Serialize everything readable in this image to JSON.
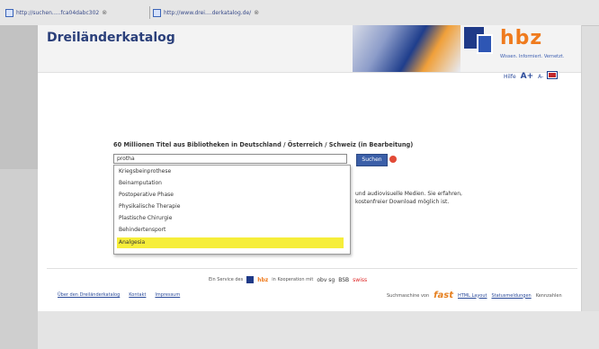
{
  "browser": {
    "tabs": [
      {
        "label": "http://suchen.....fca04dabc302"
      },
      {
        "label": "http://www.drei....derkatalog.de/"
      }
    ]
  },
  "page": {
    "title": "Dreiländerkatalog",
    "logo": {
      "text": "hbz",
      "tagline": "Wissen. Informiert. Vernetzt."
    },
    "utils": {
      "help": "Hilfe",
      "font_up": "A+",
      "font_down": "A-"
    },
    "headline": "60 Millionen Titel aus Bibliotheken in Deutschland / Österreich / Schweiz (in Bearbeitung)",
    "search": {
      "value": "protha",
      "button": "Suchen"
    },
    "suggestions": [
      {
        "label": "Kriegsbeinprothese",
        "selected": false
      },
      {
        "label": "Beinamputation",
        "selected": false
      },
      {
        "label": "Postoperative Phase",
        "selected": false
      },
      {
        "label": "Physikalische Therapie",
        "selected": false
      },
      {
        "label": "Plastische Chirurgie",
        "selected": false
      },
      {
        "label": "Behindertensport",
        "selected": false
      },
      {
        "label": "Analgesia",
        "selected": true
      }
    ],
    "description": {
      "line1": "und audiovisuelle Medien. Sie erfahren,",
      "line2": "kostenfreier Download möglich ist."
    },
    "footer": {
      "service_prefix": "Ein Service des",
      "service_hbz": "hbz",
      "service_mid": "in Kooperation mit",
      "partner1": "obv sg",
      "partner2": "BSB",
      "partner3": "swiss",
      "links": [
        "Über den Dreiländerkatalog",
        "Kontakt",
        "Impressum"
      ],
      "engine_label": "Suchmaschine von",
      "engine": "fast",
      "right_links": [
        "HTML Layout",
        "Statusmeldungen"
      ],
      "right_tail": "Kennzahlen"
    }
  },
  "colors": {
    "accent": "#2a3f7a",
    "brand": "#ef7b1e",
    "highlight": "#f6ee3a"
  }
}
